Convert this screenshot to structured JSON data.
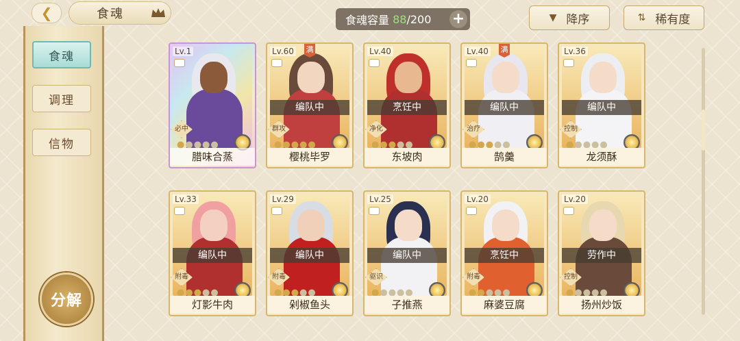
{
  "header": {
    "title": "食魂",
    "capacity_label": "食魂容量",
    "capacity_current": "88",
    "capacity_max": "/200",
    "plus_label": "+",
    "sort_order": "降序",
    "sort_by": "稀有度"
  },
  "sidebar": {
    "items": [
      {
        "label": "食魂",
        "active": true
      },
      {
        "label": "调理",
        "active": false
      },
      {
        "label": "信物",
        "active": false
      }
    ],
    "decompose_label": "分解"
  },
  "cards": [
    {
      "level": "Lv.1",
      "name": "腊味合蒸",
      "status": "",
      "role": "必中",
      "full": false,
      "stars_on": 1,
      "rainbow": true,
      "hair": "#e8e8ee",
      "skin": "#8a5a3a",
      "outfit": "#6a4a9a"
    },
    {
      "level": "Lv.60",
      "name": "樱桃毕罗",
      "status": "编队中",
      "role": "群攻",
      "full": true,
      "stars_on": 5,
      "rainbow": false,
      "hair": "#6a4a3a",
      "skin": "#f3d6bf",
      "outfit": "#c04040"
    },
    {
      "level": "Lv.40",
      "name": "东坡肉",
      "status": "烹饪中",
      "role": "净化",
      "full": false,
      "stars_on": 3,
      "rainbow": false,
      "hair": "#c0302a",
      "skin": "#e8b890",
      "outfit": "#b03030"
    },
    {
      "level": "Lv.40",
      "name": "鹄羹",
      "status": "编队中",
      "role": "治疗",
      "full": true,
      "stars_on": 3,
      "rainbow": false,
      "hair": "#e8e6ee",
      "skin": "#f4dcc8",
      "outfit": "#f0f0f4"
    },
    {
      "level": "Lv.36",
      "name": "龙须酥",
      "status": "编队中",
      "role": "控制",
      "full": false,
      "stars_on": 1,
      "rainbow": false,
      "hair": "#eceef2",
      "skin": "#f4dcc8",
      "outfit": "#f4f4f6"
    },
    {
      "level": "Lv.33",
      "name": "灯影牛肉",
      "status": "编队中",
      "role": "附毒",
      "full": false,
      "stars_on": 3,
      "rainbow": false,
      "hair": "#f0a0a0",
      "skin": "#f4d0c0",
      "outfit": "#b03030"
    },
    {
      "level": "Lv.29",
      "name": "剁椒鱼头",
      "status": "编队中",
      "role": "附毒",
      "full": false,
      "stars_on": 3,
      "rainbow": false,
      "hair": "#d8dce4",
      "skin": "#f0d0b8",
      "outfit": "#c02020"
    },
    {
      "level": "Lv.25",
      "name": "子推燕",
      "status": "编队中",
      "role": "驱识",
      "full": false,
      "stars_on": 1,
      "rainbow": false,
      "hair": "#2a3050",
      "skin": "#f4dcc8",
      "outfit": "#f2f2f4"
    },
    {
      "level": "Lv.20",
      "name": "麻婆豆腐",
      "status": "烹饪中",
      "role": "附毒",
      "full": false,
      "stars_on": 2,
      "rainbow": false,
      "hair": "#f2f2f4",
      "skin": "#f4dcc8",
      "outfit": "#e06030"
    },
    {
      "level": "Lv.20",
      "name": "扬州炒饭",
      "status": "劳作中",
      "role": "控制",
      "full": false,
      "stars_on": 1,
      "rainbow": false,
      "hair": "#e8d8b0",
      "skin": "#f4dcc8",
      "outfit": "#6a4a3a"
    }
  ],
  "full_mark_label": "满",
  "colors": {
    "accent_gold": "#d7b66c",
    "active_teal": "#a9dcd6",
    "capacity_green": "#9be37c"
  }
}
